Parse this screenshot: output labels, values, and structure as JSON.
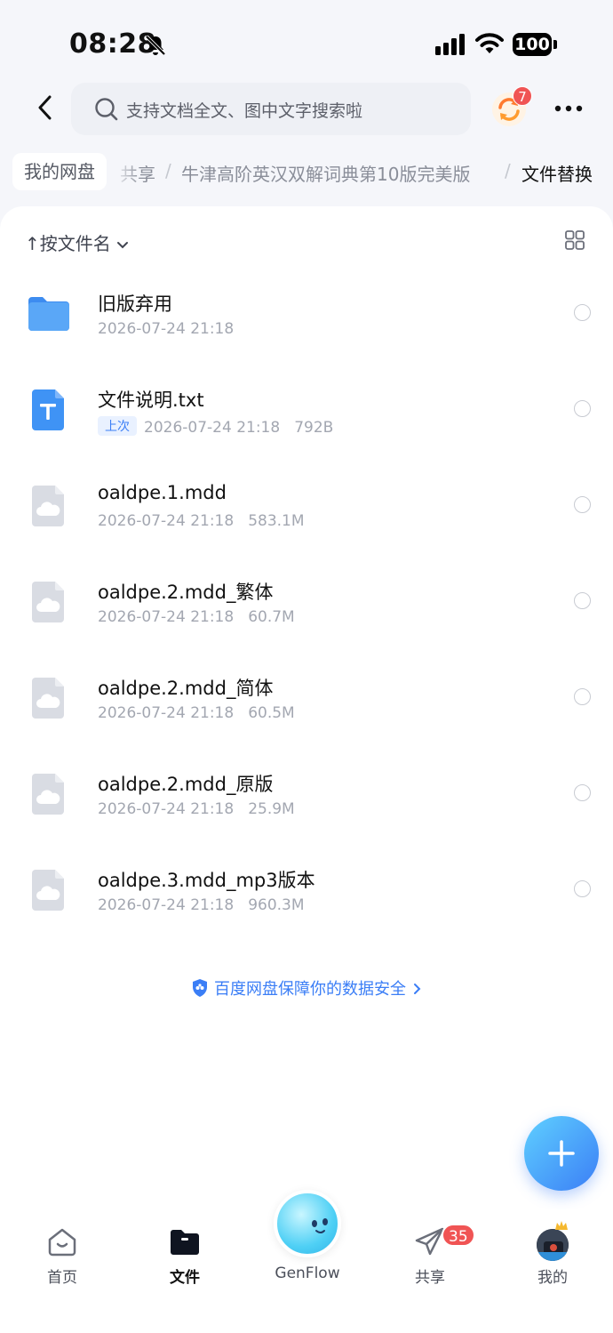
{
  "status_bar": {
    "time": "08:28",
    "battery": "100"
  },
  "header": {
    "search_placeholder": "支持文档全文、图中文字搜索啦",
    "sync_badge": "7"
  },
  "breadcrumb": {
    "root": "我的网盘",
    "items": [
      "共享",
      "牛津高阶英汉双解词典第10版完美版"
    ],
    "separator": "/",
    "current": "文件替换"
  },
  "sort": {
    "label": "按文件名",
    "arrow": "↑"
  },
  "files": [
    {
      "name": "旧版弃用",
      "date": "2026-07-24 21:18",
      "size": "",
      "type": "folder",
      "tag": ""
    },
    {
      "name": "文件说明.txt",
      "date": "2026-07-24 21:18",
      "size": "792B",
      "type": "text",
      "tag": "上次"
    },
    {
      "name": "oaldpe.1.mdd",
      "date": "2026-07-24 21:18",
      "size": "583.1M",
      "type": "cloud",
      "tag": ""
    },
    {
      "name": "oaldpe.2.mdd_繁体",
      "date": "2026-07-24 21:18",
      "size": "60.7M",
      "type": "cloud",
      "tag": ""
    },
    {
      "name": "oaldpe.2.mdd_简体",
      "date": "2026-07-24 21:18",
      "size": "60.5M",
      "type": "cloud",
      "tag": ""
    },
    {
      "name": "oaldpe.2.mdd_原版",
      "date": "2026-07-24 21:18",
      "size": "25.9M",
      "type": "cloud",
      "tag": ""
    },
    {
      "name": "oaldpe.3.mdd_mp3版本",
      "date": "2026-07-24 21:18",
      "size": "960.3M",
      "type": "cloud",
      "tag": ""
    }
  ],
  "security_note": "百度网盘保障你的数据安全",
  "nav": {
    "home": "首页",
    "files": "文件",
    "genflow": "GenFlow",
    "share": "共享",
    "share_badge": "35",
    "mine": "我的"
  },
  "colors": {
    "accent": "#3b7ef6",
    "badge": "#f05454",
    "folder": "#4a9af5"
  }
}
